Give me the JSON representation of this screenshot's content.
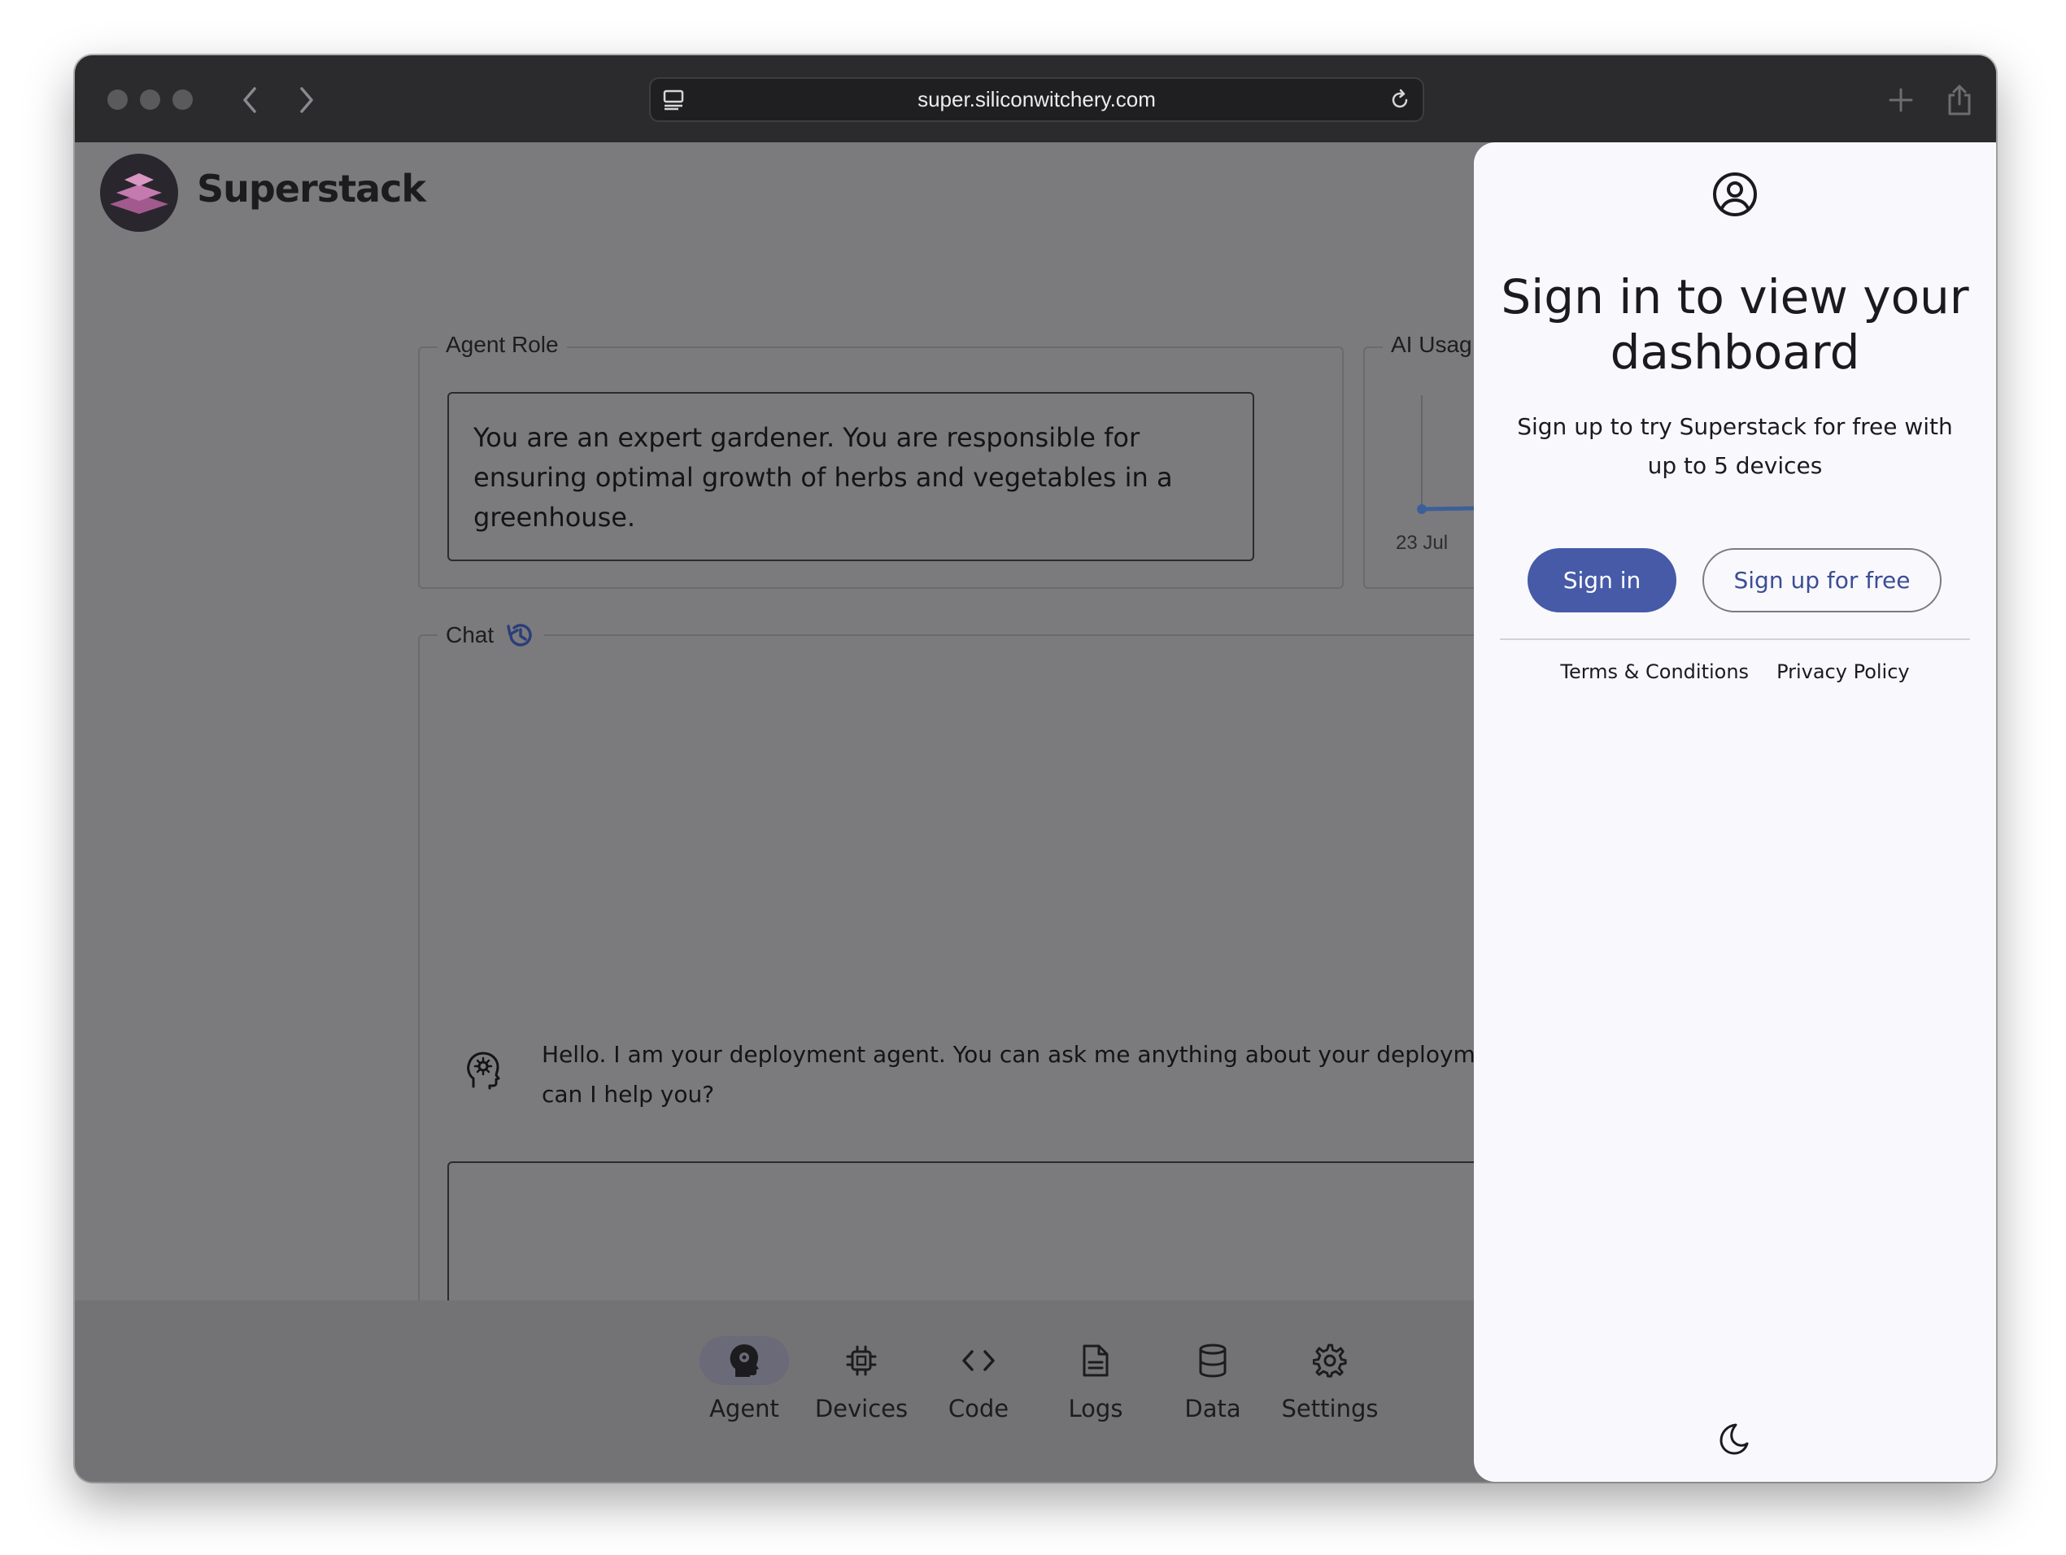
{
  "browser": {
    "url": "super.siliconwitchery.com"
  },
  "app": {
    "brand": "Superstack"
  },
  "agent_role": {
    "legend": "Agent Role",
    "text": "You are an expert gardener. You are responsible for ensuring optimal growth of herbs and vegetables in a greenhouse."
  },
  "ai_usage": {
    "legend": "AI Usag",
    "date_label": "23 Jul"
  },
  "chat": {
    "legend": "Chat",
    "message_line1": "Hello. I am your deployment agent. You can ask me anything about your deployment or",
    "message_line2": "can I help you?"
  },
  "nav": {
    "items": [
      {
        "label": "Agent",
        "icon": "agent-icon",
        "active": true
      },
      {
        "label": "Devices",
        "icon": "chip-icon"
      },
      {
        "label": "Code",
        "icon": "code-icon"
      },
      {
        "label": "Logs",
        "icon": "document-icon"
      },
      {
        "label": "Data",
        "icon": "database-icon"
      },
      {
        "label": "Settings",
        "icon": "gear-icon"
      }
    ]
  },
  "signin_panel": {
    "title": "Sign in to view your dashboard",
    "subtitle": "Sign up to try Superstack for free with up to 5 devices",
    "signin_label": "Sign in",
    "signup_label": "Sign up for free",
    "terms_label": "Terms & Conditions",
    "privacy_label": "Privacy Policy"
  },
  "colors": {
    "primary": "#465aa8",
    "overlay": "#7b7b7d",
    "drawer_bg": "#f9f8fc"
  }
}
